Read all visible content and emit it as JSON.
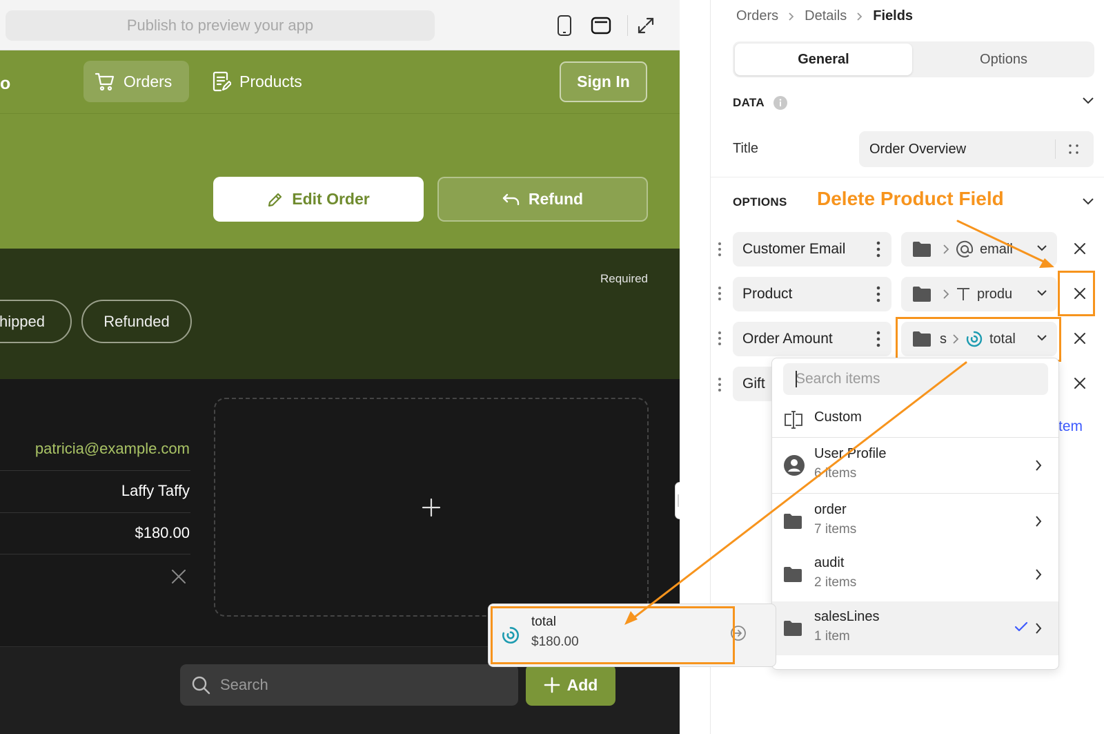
{
  "preview": {
    "url_placeholder": "Publish to preview your app",
    "brand_tail": "o",
    "nav": {
      "orders": "Orders",
      "products": "Products",
      "sign_in": "Sign In"
    },
    "actions": {
      "edit_order": "Edit Order",
      "refund": "Refund"
    },
    "status": {
      "required": "Required",
      "pills": [
        "hipped",
        "Refunded"
      ]
    },
    "details": {
      "email": "patricia@example.com",
      "product": "Laffy Taffy",
      "amount": "$180.00"
    },
    "search_placeholder": "Search",
    "add_label": "Add"
  },
  "panel": {
    "breadcrumb": [
      "Orders",
      "Details",
      "Fields"
    ],
    "tabs": [
      "General",
      "Options"
    ],
    "data_section": "DATA",
    "title_label": "Title",
    "title_value": "Order Overview",
    "options_section": "OPTIONS",
    "annotation": "Delete Product Field",
    "fields": [
      {
        "name": "Customer Email",
        "path_icon": "at-icon",
        "path_value": "email"
      },
      {
        "name": "Product",
        "path_icon": "text-icon",
        "path_value": "produ"
      },
      {
        "name": "Order Amount",
        "path_prefix": "s",
        "path_icon": "number-icon",
        "path_value": "total"
      },
      {
        "name": "Gift"
      }
    ],
    "add_item_partial": "tem"
  },
  "dropdown": {
    "search_placeholder": "Search items",
    "custom_label": "Custom",
    "items": [
      {
        "name": "User Profile",
        "count": "6 items"
      },
      {
        "name": "order",
        "count": "7 items"
      },
      {
        "name": "audit",
        "count": "2 items"
      },
      {
        "name": "salesLines",
        "count": "1 item"
      }
    ]
  },
  "total_card": {
    "name": "total",
    "value": "$180.00"
  },
  "colors": {
    "brand_green": "#7b9638",
    "annotation_orange": "#f7941d",
    "link_blue": "#3d5afe",
    "check_blue": "#3d5afe"
  }
}
